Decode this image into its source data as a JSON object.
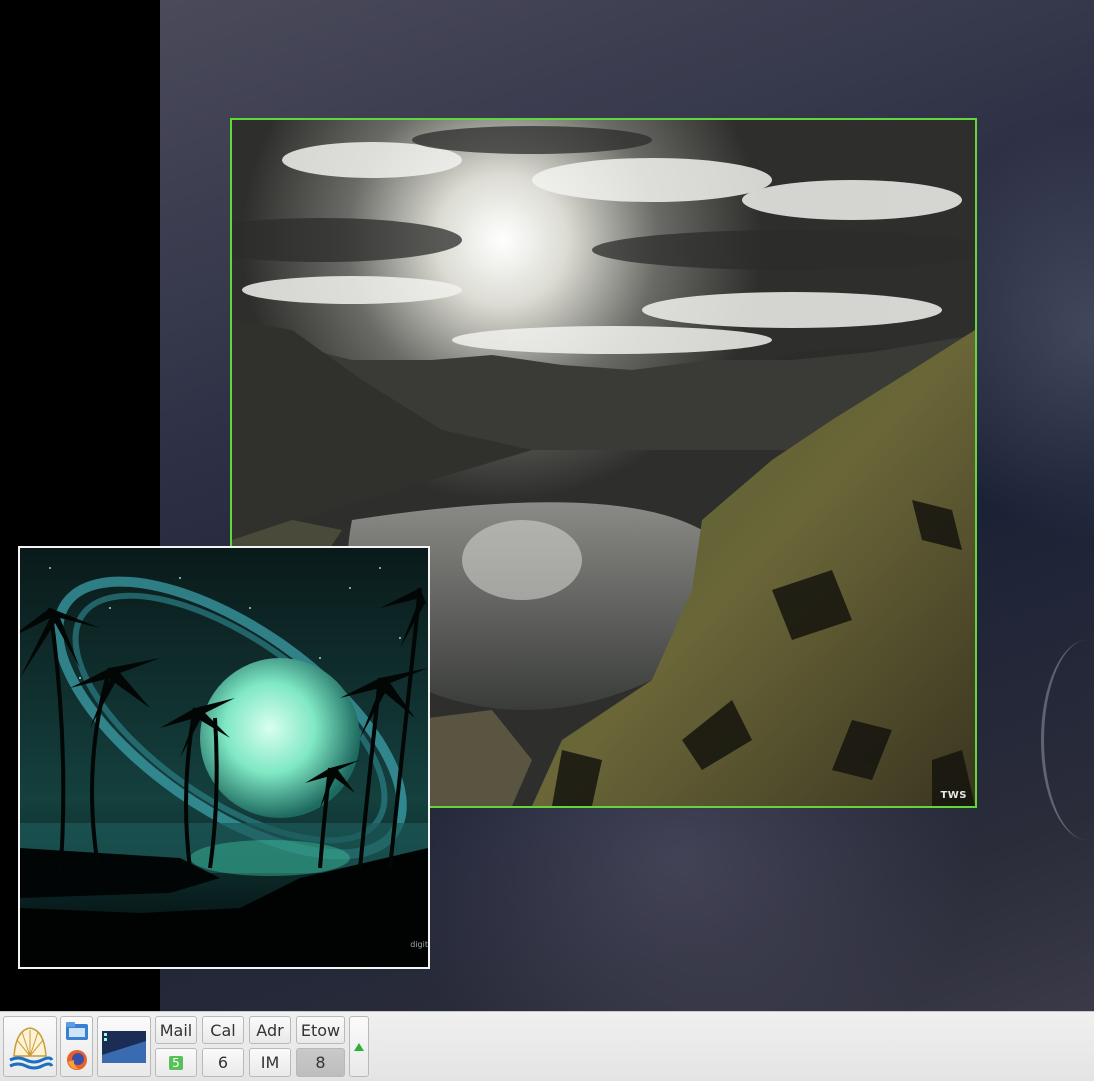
{
  "windows": {
    "landscape": {
      "watermark": "TWS"
    },
    "tropical": {
      "watermark": "digit"
    }
  },
  "panel": {
    "launchers": [
      {
        "icon": "shell-logo-icon"
      },
      {
        "icon": "file-manager-icon"
      },
      {
        "icon": "firefox-icon"
      },
      {
        "icon": "screen-preview-icon"
      }
    ],
    "buttons": {
      "mail": "Mail",
      "cal": "Cal",
      "adr": "Adr",
      "etow": "Etow",
      "five": "5",
      "six": "6",
      "im": "IM",
      "eight": "8"
    },
    "expand_icon": "triangle-up-icon"
  },
  "colors": {
    "focus_border": "#62d63a",
    "panel_bg": "#e8e8e8",
    "active_workspace": "#c4c4c4"
  }
}
